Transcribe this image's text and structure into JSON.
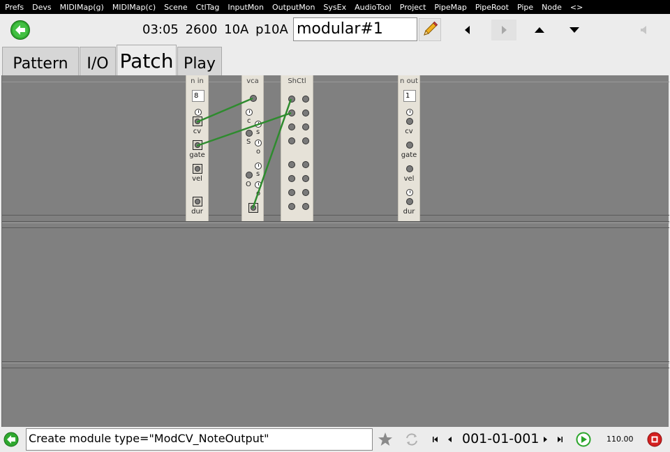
{
  "menu": [
    "Prefs",
    "Devs",
    "MIDIMap(g)",
    "MIDIMap(c)",
    "Scene",
    "CtlTag",
    "InputMon",
    "OutputMon",
    "SysEx",
    "AudioTool",
    "Project",
    "PipeMap",
    "PipeRoot",
    "Pipe",
    "Node",
    "<>"
  ],
  "status": {
    "time": "03:05",
    "bpm": "2600",
    "track": "10A",
    "pattern": "p10A :"
  },
  "name_field": {
    "value": "modular#1"
  },
  "tabs": [
    "Pattern",
    "I/O",
    "Patch",
    "Play"
  ],
  "active_tab": "Patch",
  "modules": {
    "n_in": {
      "title": "n in",
      "value": "8",
      "labels": [
        "cv",
        "gate",
        "vel",
        "dur"
      ]
    },
    "vca": {
      "title": "vca",
      "labels": [
        "c",
        "S",
        "s",
        "o",
        "O",
        "s",
        "o"
      ]
    },
    "shctl": {
      "title": "ShCtl"
    },
    "n_out": {
      "title": "n out",
      "value": "1",
      "labels": [
        "cv",
        "gate",
        "vel",
        "dur"
      ]
    }
  },
  "command": {
    "value": "Create module type=\"ModCV_NoteOutput\""
  },
  "transport": {
    "position": "001-01-001",
    "tempo": "110.00"
  },
  "colors": {
    "wire": "#2e8b2e",
    "canvas": "#808080",
    "module": "#e6e2d8",
    "play": "#2aa52a",
    "stop": "#d42020"
  },
  "icons": [
    "back-arrow-icon",
    "pencil-icon",
    "triangle-left-icon",
    "triangle-right-icon",
    "triangle-up-icon",
    "triangle-down-icon",
    "speaker-icon",
    "star-icon",
    "loop-icon",
    "skip-start-icon",
    "step-back-icon",
    "step-forward-icon",
    "skip-end-icon",
    "play-icon",
    "stop-icon"
  ]
}
